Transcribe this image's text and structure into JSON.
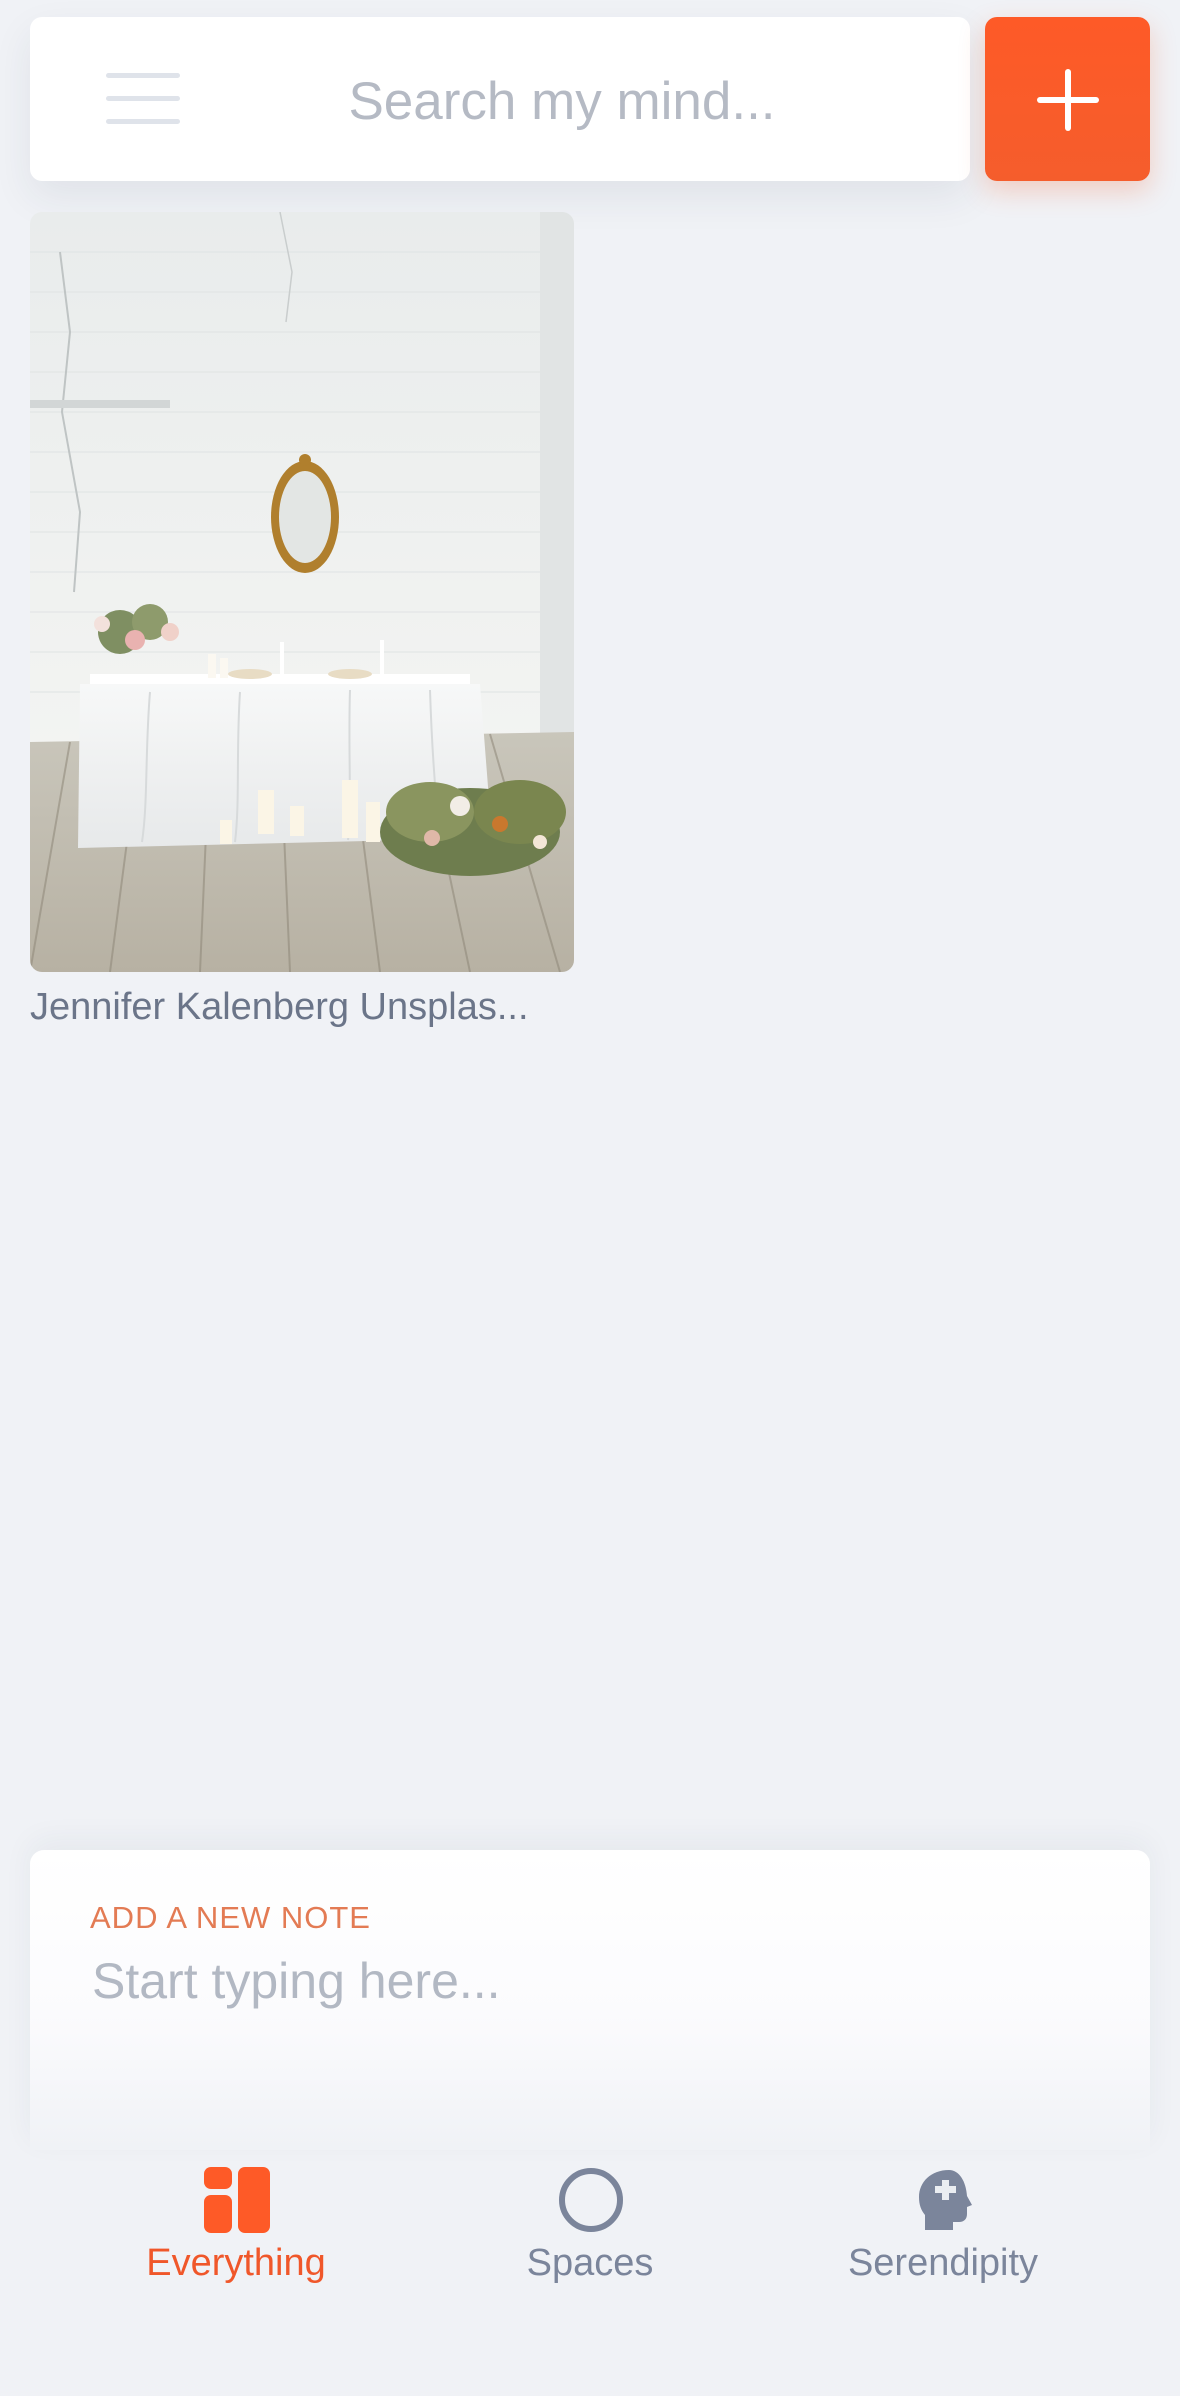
{
  "search": {
    "placeholder": "Search my mind..."
  },
  "cards": [
    {
      "caption": "Jennifer Kalenberg Unsplas..."
    }
  ],
  "note": {
    "label": "ADD A NEW NOTE",
    "placeholder": "Start typing here..."
  },
  "nav": {
    "items": [
      {
        "label": "Everything",
        "icon": "everything-grid-icon",
        "active": true
      },
      {
        "label": "Spaces",
        "icon": "circle-icon",
        "active": false
      },
      {
        "label": "Serendipity",
        "icon": "head-profile-icon",
        "active": false
      }
    ]
  },
  "colors": {
    "accent": "#fe5a27",
    "background": "#f0f2f6",
    "muted_text": "#6b7589",
    "note_label": "#e37b54"
  }
}
